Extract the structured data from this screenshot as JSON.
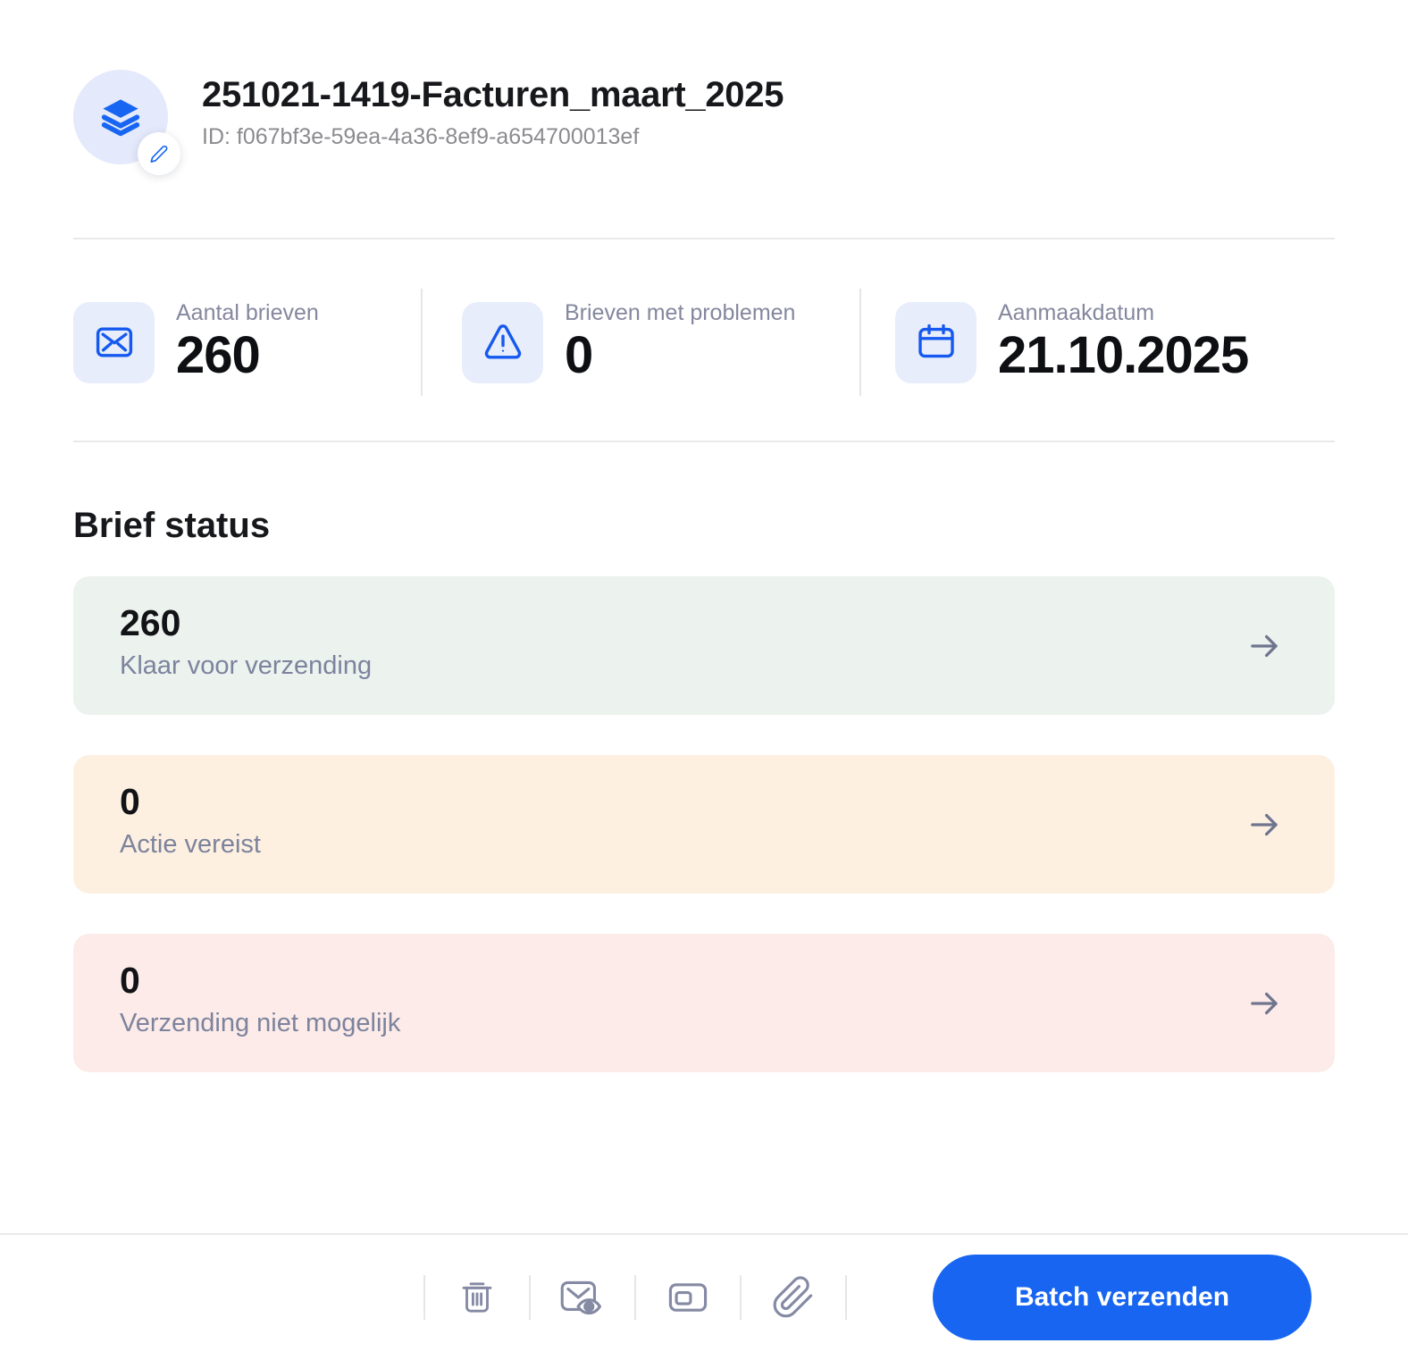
{
  "header": {
    "title": "251021-1419-Facturen_maart_2025",
    "batch_id": "ID: f067bf3e-59ea-4a36-8ef9-a654700013ef",
    "avatar_icon": "layers-icon",
    "edit_icon": "pencil-icon"
  },
  "stats": [
    {
      "icon": "envelope-icon",
      "label": "Aantal brieven",
      "value": "260"
    },
    {
      "icon": "alert-triangle-icon",
      "label": "Brieven met problemen",
      "value": "0"
    },
    {
      "icon": "calendar-icon",
      "label": "Aanmaakdatum",
      "value": "21.10.2025"
    }
  ],
  "status_section": {
    "heading": "Brief status",
    "arrow_icon": "arrow-right-icon",
    "cards": [
      {
        "count": "260",
        "label": "Klaar voor verzending",
        "status": "ready",
        "bg_color": "#ecf2ee"
      },
      {
        "count": "0",
        "label": "Actie vereist",
        "status": "action-required",
        "bg_color": "#fdf0e1"
      },
      {
        "count": "0",
        "label": "Verzending niet mogelijk",
        "status": "not-possible",
        "bg_color": "#fcebe8"
      }
    ]
  },
  "footer": {
    "tools": [
      {
        "icon": "trash-icon"
      },
      {
        "icon": "mail-preview-icon"
      },
      {
        "icon": "envelope-window-icon"
      },
      {
        "icon": "paperclip-icon"
      }
    ],
    "primary_button_label": "Batch verzenden"
  },
  "colors": {
    "accent_blue": "#1765f1",
    "icon_tile_bg": "#e8edfc",
    "avatar_bg": "#e4e9fb",
    "ready_bg": "#ecf2ee",
    "action_bg": "#fdf0e1",
    "blocked_bg": "#fcebe8",
    "toolbar_icon": "#858aa4",
    "muted_label": "#84889e"
  }
}
